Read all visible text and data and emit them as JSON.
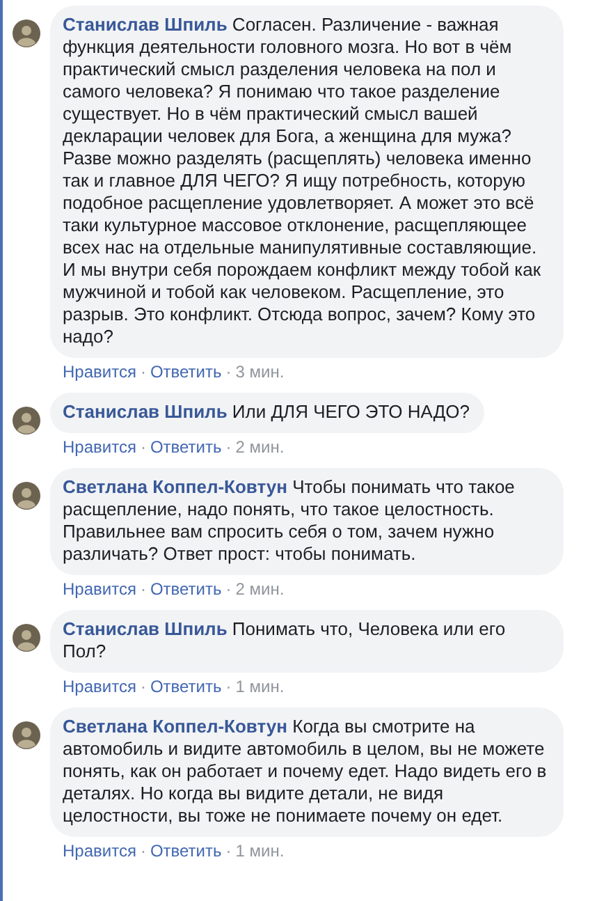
{
  "comments": [
    {
      "author": "Станислав Шпиль",
      "text": "Согласен. Различение - важная функция деятельности головного мозга. Но вот в чём практический смысл разделения человека на пол и самого человека? Я понимаю что такое разделение существует. Но в чём практический смысл вашей декларации человек для Бога, а женщина для мужа? Разве можно разделять (расщеплять) человека именно так и главное ДЛЯ ЧЕГО? Я ищу потребность, которую подобное расщепление удовлетворяет. А может это всё таки культурное массовое отклонение, расщепляющее всех нас на отдельные манипулятивные составляющие. И мы внутри себя порождаем конфликт между тобой как мужчиной и тобой как человеком. Расщепление, это разрыв. Это конфликт. Отсюда вопрос, зачем? Кому это надо?",
      "like": "Нравится",
      "sep1": "·",
      "reply": "Ответить",
      "sep2": "·",
      "time": "3 мин."
    },
    {
      "author": "Станислав Шпиль",
      "text": "Или ДЛЯ ЧЕГО ЭТО НАДО?",
      "like": "Нравится",
      "sep1": "·",
      "reply": "Ответить",
      "sep2": "·",
      "time": "2 мин."
    },
    {
      "author": "Светлана Коппел-Ковтун",
      "text": "Чтобы понимать что такое расщепление, надо понять, что такое целостность. Правильнее вам спросить себя о том, зачем нужно различать? Ответ прост: чтобы понимать.",
      "like": "Нравится",
      "sep1": "·",
      "reply": "Ответить",
      "sep2": "·",
      "time": "2 мин."
    },
    {
      "author": "Станислав Шпиль",
      "text": "Понимать что, Человека или его Пол?",
      "like": "Нравится",
      "sep1": "·",
      "reply": "Ответить",
      "sep2": "·",
      "time": "1 мин."
    },
    {
      "author": "Светлана Коппел-Ковтун",
      "text": "Когда вы смотрите на автомобиль и видите автомобиль в целом, вы не можете понять, как он работает и почему едет. Надо видеть его в деталях. Но когда вы видите детали, не видя целостности, вы тоже не понимаете почему он едет.",
      "like": "Нравится",
      "sep1": "·",
      "reply": "Ответить",
      "sep2": "·",
      "time": "1 мин."
    }
  ]
}
